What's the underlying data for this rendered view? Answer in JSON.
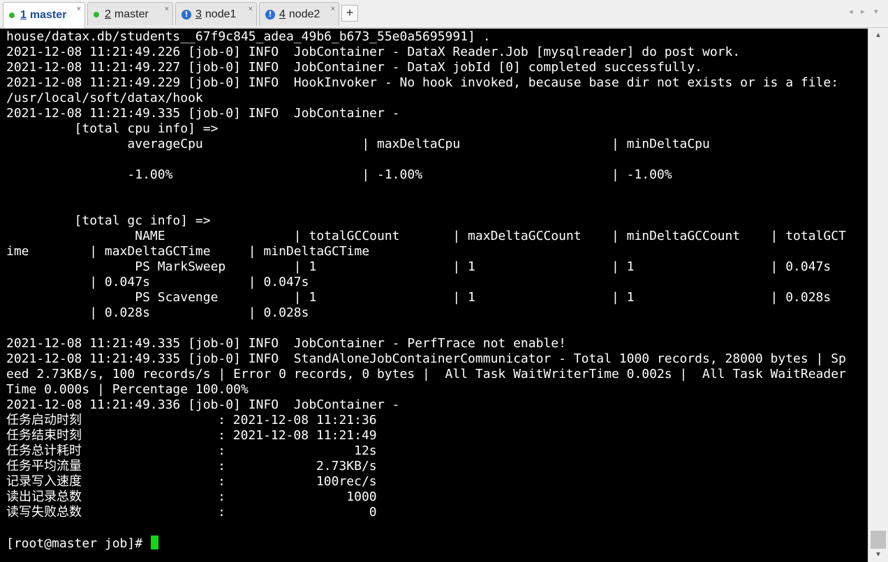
{
  "tabs": [
    {
      "num": "1",
      "name": "master",
      "status": "connected"
    },
    {
      "num": "2",
      "name": "master",
      "status": "connected"
    },
    {
      "num": "3",
      "name": "node1",
      "status": "info"
    },
    {
      "num": "4",
      "name": "node2",
      "status": "info"
    }
  ],
  "tab_close_glyph": "×",
  "tab_add_glyph": "+",
  "tab_nav": {
    "prev": "◂",
    "next": "▸",
    "menu": "▾"
  },
  "terminal": {
    "lines": [
      "house/datax.db/students__67f9c845_adea_49b6_b673_55e0a5695991] .",
      "2021-12-08 11:21:49.226 [job-0] INFO  JobContainer - DataX Reader.Job [mysqlreader] do post work.",
      "2021-12-08 11:21:49.227 [job-0] INFO  JobContainer - DataX jobId [0] completed successfully.",
      "2021-12-08 11:21:49.229 [job-0] INFO  HookInvoker - No hook invoked, because base dir not exists or is a file:",
      "/usr/local/soft/datax/hook",
      "2021-12-08 11:21:49.335 [job-0] INFO  JobContainer -",
      "         [total cpu info] =>",
      "                averageCpu                     | maxDeltaCpu                    | minDeltaCpu",
      "",
      "                -1.00%                         | -1.00%                         | -1.00%",
      "",
      "",
      "         [total gc info] =>",
      "                 NAME                 | totalGCCount       | maxDeltaGCCount    | minDeltaGCCount    | totalGCT",
      "ime        | maxDeltaGCTime     | minDeltaGCTime",
      "                 PS MarkSweep         | 1                  | 1                  | 1                  | 0.047s",
      "           | 0.047s             | 0.047s",
      "                 PS Scavenge          | 1                  | 1                  | 1                  | 0.028s",
      "           | 0.028s             | 0.028s",
      "",
      "2021-12-08 11:21:49.335 [job-0] INFO  JobContainer - PerfTrace not enable!",
      "2021-12-08 11:21:49.335 [job-0] INFO  StandAloneJobContainerCommunicator - Total 1000 records, 28000 bytes | Sp",
      "eed 2.73KB/s, 100 records/s | Error 0 records, 0 bytes |  All Task WaitWriterTime 0.002s |  All Task WaitReader",
      "Time 0.000s | Percentage 100.00%",
      "2021-12-08 11:21:49.336 [job-0] INFO  JobContainer -",
      "任务启动时刻                  : 2021-12-08 11:21:36",
      "任务结束时刻                  : 2021-12-08 11:21:49",
      "任务总计耗时                  :                 12s",
      "任务平均流量                  :            2.73KB/s",
      "记录写入速度                  :            100rec/s",
      "读出记录总数                  :                1000",
      "读写失败总数                  :                   0",
      "",
      "[root@master job]# "
    ]
  },
  "scrollbar": {
    "up": "▲",
    "down": "▼"
  },
  "colors": {
    "terminal_bg": "#000000",
    "terminal_fg": "#ffffff",
    "cursor": "#11d711",
    "active_tab_text": "#1a4fa0",
    "connected_dot": "#2fb52f",
    "info_badge": "#2a6fd6"
  }
}
